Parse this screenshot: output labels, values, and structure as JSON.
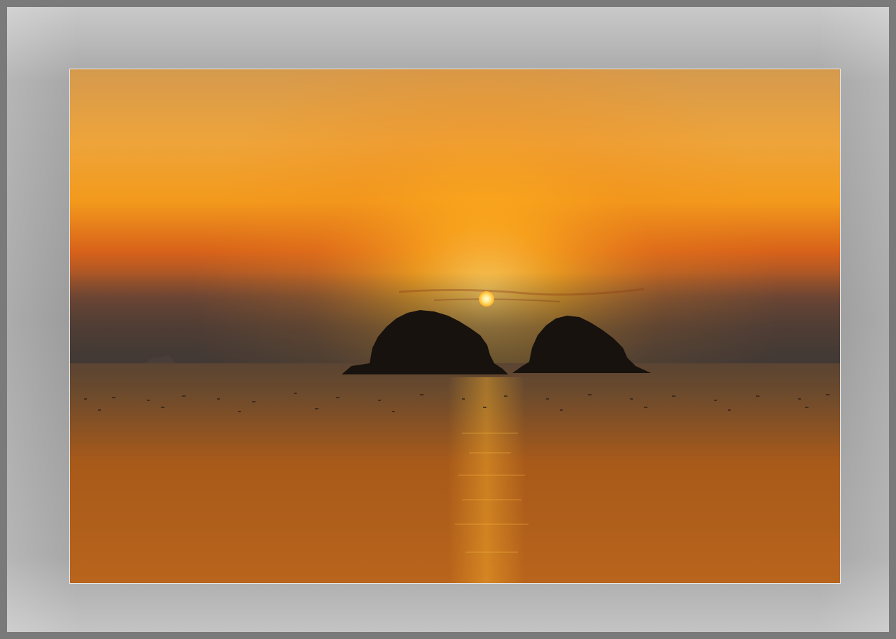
{
  "scene": {
    "subject": "sunset-over-sea",
    "colors": {
      "frame": "#9a9a9a",
      "sky_top": "#d59a4a",
      "sky_glow": "#f5a623",
      "sun": "#fff6c8",
      "haze": "#4a3f3a",
      "sea": "#c06a1a",
      "islands": "#16120e"
    }
  }
}
